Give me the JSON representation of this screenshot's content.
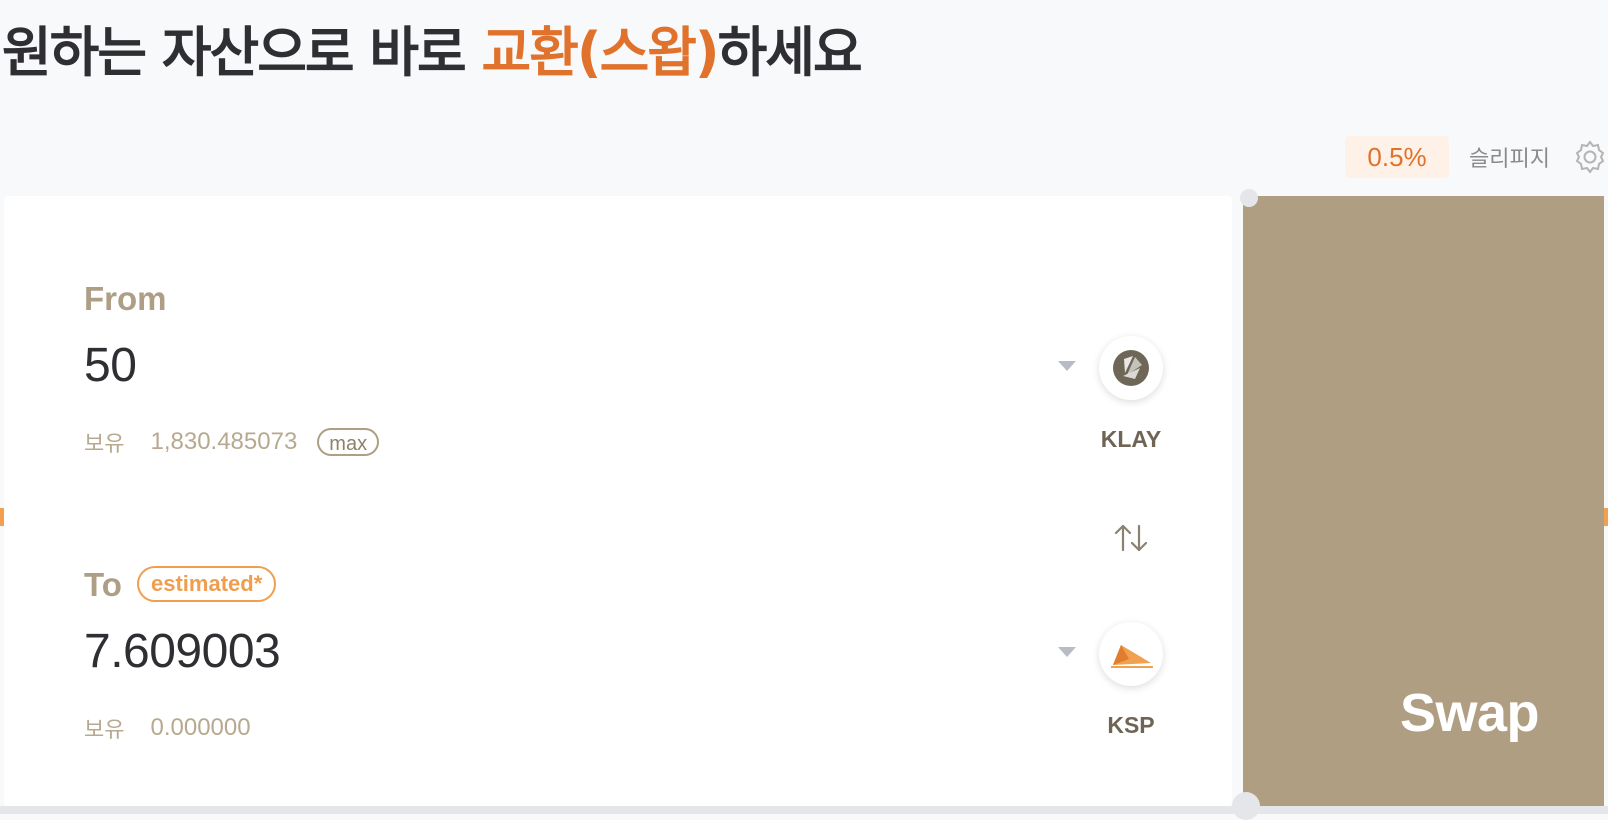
{
  "headline": {
    "part1": "원하는 자산으로 바로 ",
    "accent": "교환(스왑)",
    "part2": "하세요"
  },
  "slippage": {
    "value": "0.5%",
    "label": "슬리피지",
    "icon": "gear-icon"
  },
  "from": {
    "label": "From",
    "amount": "50",
    "balance_label": "보유",
    "balance": "1,830.485073",
    "max_label": "max",
    "token": {
      "symbol": "KLAY",
      "icon": "klay-token-icon"
    }
  },
  "switch_icon": "swap-direction-icon",
  "to": {
    "label": "To",
    "badge": "estimated*",
    "amount": "7.609003",
    "balance_label": "보유",
    "balance": "0.000000",
    "token": {
      "symbol": "KSP",
      "icon": "ksp-token-icon"
    }
  },
  "swap_button": {
    "label": "Swap"
  },
  "colors": {
    "accent": "#e0722c",
    "tan": "#af9e82",
    "badge": "#f09e4e",
    "background": "#f8f9fb"
  }
}
